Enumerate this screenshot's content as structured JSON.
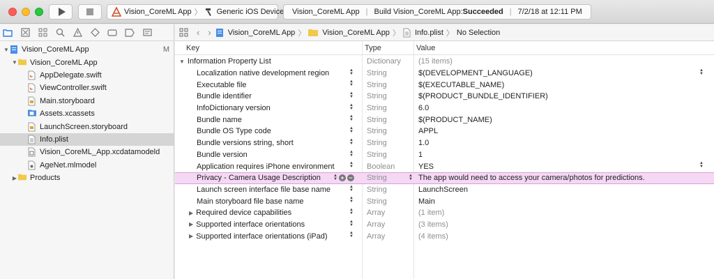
{
  "toolbar": {
    "scheme_name": "Vision_CoreML App",
    "device": "Generic iOS Device",
    "activity_project": "Vision_CoreML App",
    "activity_status_prefix": "Build Vision_CoreML App: ",
    "activity_status": "Succeeded",
    "activity_time": "7/2/18 at 12:11 PM"
  },
  "navigator": {
    "project": "Vision_CoreML App",
    "project_badge": "M",
    "group": "Vision_CoreML App",
    "files": [
      "AppDelegate.swift",
      "ViewController.swift",
      "Main.storyboard",
      "Assets.xcassets",
      "LaunchScreen.storyboard",
      "Info.plist",
      "Vision_CoreML_App.xcdatamodeld",
      "AgeNet.mlmodel"
    ],
    "products": "Products"
  },
  "jumpbar": {
    "crumb1": "Vision_CoreML App",
    "crumb2": "Vision_CoreML App",
    "crumb3": "Info.plist",
    "crumb4": "No Selection"
  },
  "plist": {
    "headers": {
      "key": "Key",
      "type": "Type",
      "value": "Value"
    },
    "root": {
      "key": "Information Property List",
      "type": "Dictionary",
      "value": "(15 items)"
    },
    "rows": [
      {
        "key": "Localization native development region",
        "type": "String",
        "value": "$(DEVELOPMENT_LANGUAGE)"
      },
      {
        "key": "Executable file",
        "type": "String",
        "value": "$(EXECUTABLE_NAME)"
      },
      {
        "key": "Bundle identifier",
        "type": "String",
        "value": "$(PRODUCT_BUNDLE_IDENTIFIER)"
      },
      {
        "key": "InfoDictionary version",
        "type": "String",
        "value": "6.0"
      },
      {
        "key": "Bundle name",
        "type": "String",
        "value": "$(PRODUCT_NAME)"
      },
      {
        "key": "Bundle OS Type code",
        "type": "String",
        "value": "APPL"
      },
      {
        "key": "Bundle versions string, short",
        "type": "String",
        "value": "1.0"
      },
      {
        "key": "Bundle version",
        "type": "String",
        "value": "1"
      },
      {
        "key": "Application requires iPhone environment",
        "type": "Boolean",
        "value": "YES"
      },
      {
        "key": "Privacy - Camera Usage Description",
        "type": "String",
        "value": "The app would need to access your camera/photos for predictions."
      },
      {
        "key": "Launch screen interface file base name",
        "type": "String",
        "value": "LaunchScreen"
      },
      {
        "key": "Main storyboard file base name",
        "type": "String",
        "value": "Main"
      },
      {
        "key": "Required device capabilities",
        "type": "Array",
        "value": "(1 item)"
      },
      {
        "key": "Supported interface orientations",
        "type": "Array",
        "value": "(3 items)"
      },
      {
        "key": "Supported interface orientations (iPad)",
        "type": "Array",
        "value": "(4 items)"
      }
    ]
  },
  "colors": {
    "highlight_row": "#f4d8f4",
    "folder": "#f0c94a",
    "swift": "#e8623d",
    "selection": "#d5d5d5"
  }
}
